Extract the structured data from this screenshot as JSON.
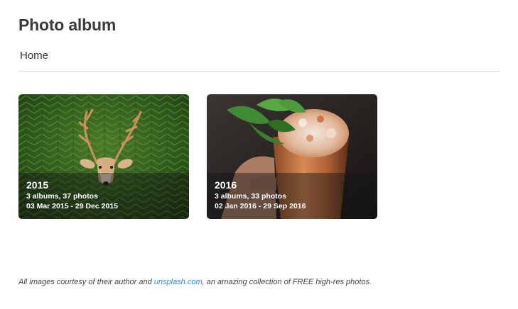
{
  "header": {
    "title": "Photo album"
  },
  "breadcrumb": {
    "home_label": "Home"
  },
  "albums": [
    {
      "year": "2015",
      "count_text": "3 albums, 37 photos",
      "date_range": "03 Mar 2015 - 29 Dec 2015",
      "image_subject": "deer in ferns"
    },
    {
      "year": "2016",
      "count_text": "3 albums, 33 photos",
      "date_range": "02 Jan 2016 - 29 Sep 2016",
      "image_subject": "mint julep in copper cup"
    }
  ],
  "footer": {
    "text_before": "All images courtesy of their author and ",
    "link_text": "unsplash.com",
    "text_after": ", an amazing collection of FREE high-res photos."
  },
  "colors": {
    "link": "#2a8fd1",
    "title": "#3a3a3a"
  }
}
